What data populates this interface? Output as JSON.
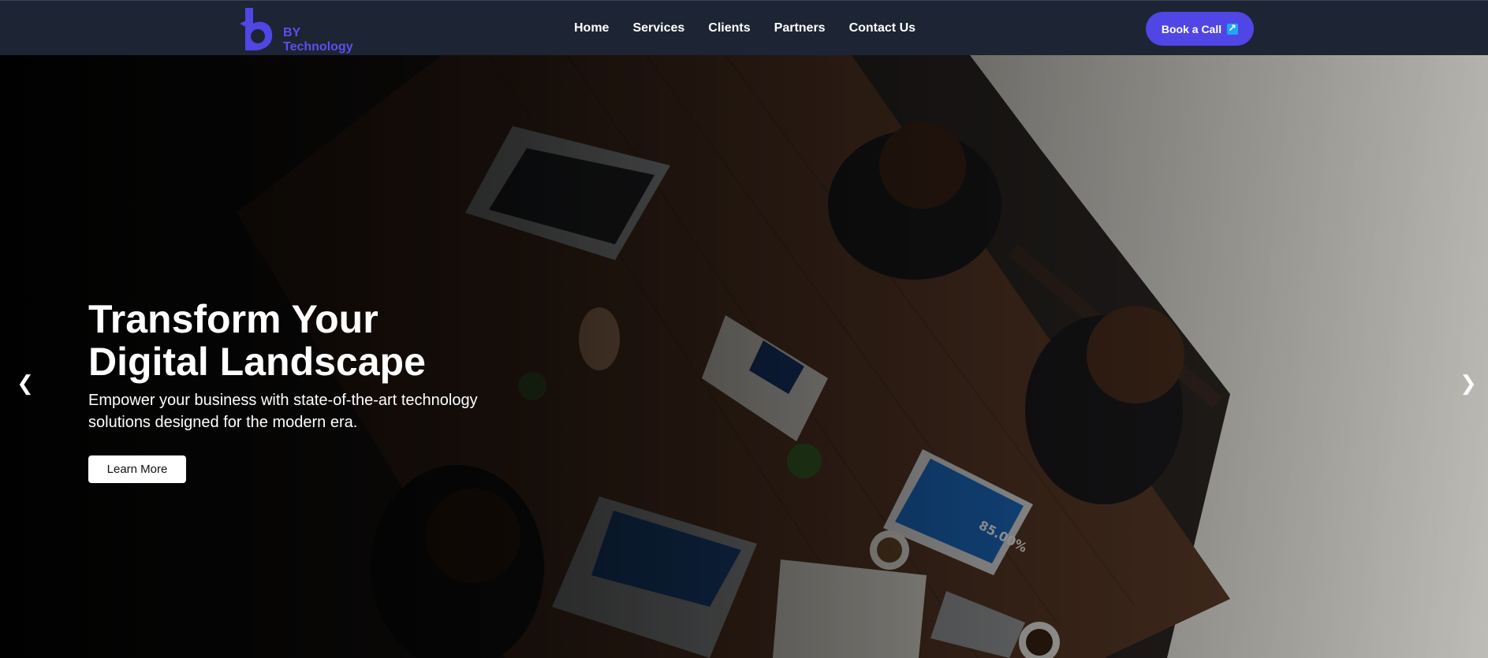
{
  "brand": {
    "line1": "BY",
    "line2": "Technology",
    "color": "#4f46e5"
  },
  "nav": {
    "items": [
      {
        "label": "Home"
      },
      {
        "label": "Services"
      },
      {
        "label": "Clients"
      },
      {
        "label": "Partners"
      },
      {
        "label": "Contact Us"
      }
    ],
    "cta": {
      "label": "Book a Call",
      "icon": "external-link-icon"
    }
  },
  "hero": {
    "title_line1": "Transform Your",
    "title_line2": "Digital Landscape",
    "subtitle": "Empower your business with state-of-the-art technology solutions designed for the modern era.",
    "button": "Learn More",
    "tablet_stat": "85.00%",
    "prev_icon": "chevron-left-icon",
    "next_icon": "chevron-right-icon"
  },
  "colors": {
    "nav_bg": "#1d2433",
    "accent": "#4f46e5",
    "link_icon": "#1ea7f5"
  }
}
